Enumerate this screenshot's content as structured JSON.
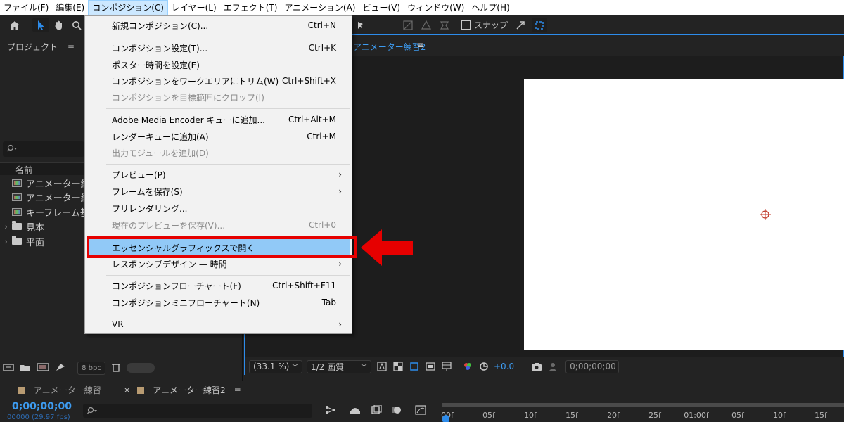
{
  "menubar": {
    "items": [
      "ファイル(F)",
      "編集(E)",
      "コンポジション(C)",
      "レイヤー(L)",
      "エフェクト(T)",
      "アニメーション(A)",
      "ビュー(V)",
      "ウィンドウ(W)",
      "ヘルプ(H)"
    ],
    "active_index": 2
  },
  "toolbar": {
    "snap_label": "スナップ"
  },
  "project": {
    "title": "プロジェクト",
    "col_name": "名前",
    "items": [
      {
        "label": "アニメーター練",
        "kind": "comp"
      },
      {
        "label": "アニメーター練",
        "kind": "comp"
      },
      {
        "label": "キーフレーム基",
        "kind": "comp"
      },
      {
        "label": "見本",
        "kind": "folder"
      },
      {
        "label": "平面",
        "kind": "folder"
      }
    ],
    "bpc": "8 bpc"
  },
  "viewer": {
    "tab_label": "アニメーター練習2",
    "zoom": "(33.1 %)",
    "quality": "1/2 画質",
    "exposure": "+0.0",
    "timecode": "0;00;00;00",
    "accent_color": "#2d8ceb"
  },
  "dropdown": {
    "items": [
      {
        "label": "新規コンポジション(C)...",
        "shortcut": "Ctrl+N"
      },
      {
        "label": "コンポジション設定(T)...",
        "shortcut": "Ctrl+K"
      },
      {
        "label": "ポスター時間を設定(E)",
        "shortcut": ""
      },
      {
        "label": "コンポジションをワークエリアにトリム(W)",
        "shortcut": "Ctrl+Shift+X"
      },
      {
        "label": "コンポジションを目標範囲にクロップ(I)",
        "shortcut": "",
        "disabled": true
      },
      {
        "label": "Adobe Media Encoder キューに追加...",
        "shortcut": "Ctrl+Alt+M"
      },
      {
        "label": "レンダーキューに追加(A)",
        "shortcut": "Ctrl+M"
      },
      {
        "label": "出力モジュールを追加(D)",
        "shortcut": "",
        "disabled": true
      },
      {
        "label": "プレビュー(P)",
        "shortcut": "",
        "submenu": true
      },
      {
        "label": "フレームを保存(S)",
        "shortcut": "",
        "submenu": true
      },
      {
        "label": "プリレンダリング...",
        "shortcut": ""
      },
      {
        "label": "現在のプレビューを保存(V)...",
        "shortcut": "Ctrl+0",
        "disabled": true
      },
      {
        "label": "エッセンシャルグラフィックスで開く",
        "shortcut": "",
        "highlighted": true
      },
      {
        "label": "レスポンシブデザイン — 時間",
        "shortcut": "",
        "submenu": true
      },
      {
        "label": "コンポジションフローチャート(F)",
        "shortcut": "Ctrl+Shift+F11"
      },
      {
        "label": "コンポジションミニフローチャート(N)",
        "shortcut": "Tab"
      },
      {
        "label": "VR",
        "shortcut": "",
        "submenu": true
      }
    ]
  },
  "timeline": {
    "tabs": [
      {
        "label": "アニメーター練習"
      },
      {
        "label": "アニメーター練習2"
      }
    ],
    "timecode": "0;00;00;00",
    "frame_info": "00000 (29.97 fps)",
    "ruler_ticks": [
      "00f",
      "05f",
      "10f",
      "15f",
      "20f",
      "25f",
      "01:00f",
      "05f",
      "10f",
      "15f"
    ]
  },
  "colors": {
    "annotation_red": "#e60000",
    "menu_highlight": "#91c9f7",
    "timecode_blue": "#3d9bf0"
  }
}
